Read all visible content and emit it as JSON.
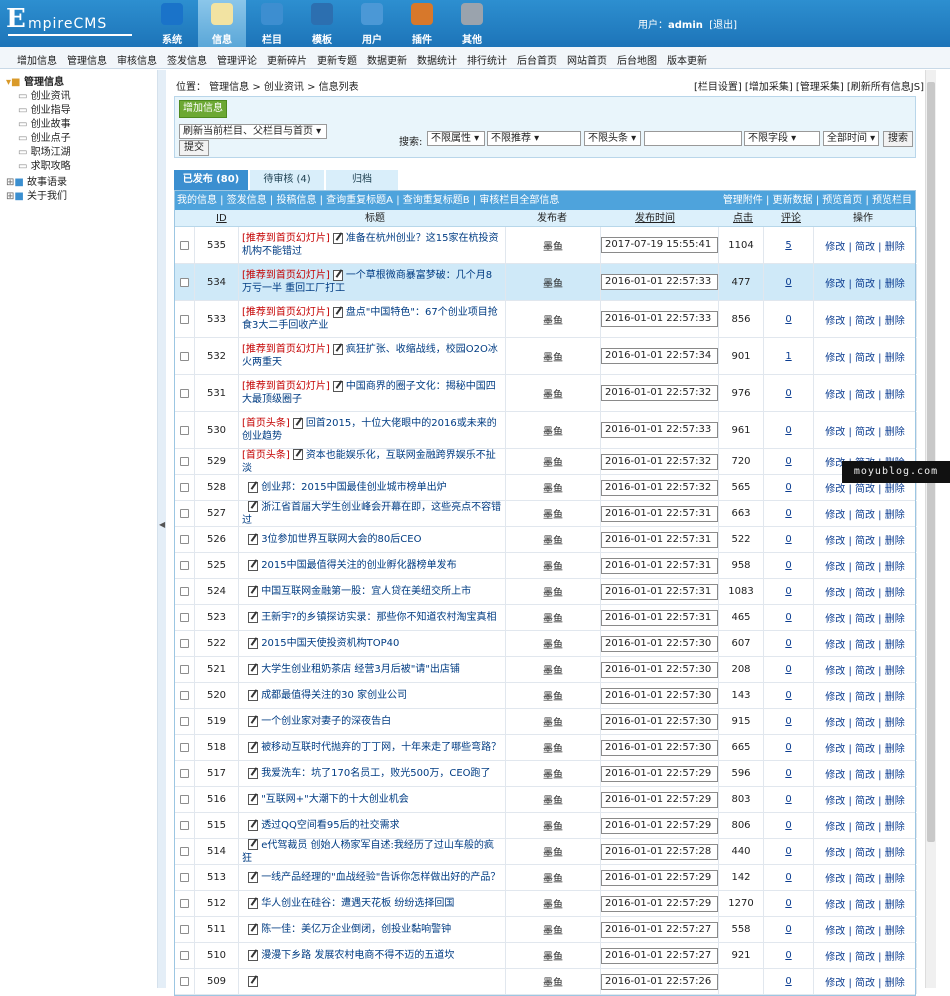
{
  "logo": {
    "first": "E",
    "rest": "mpireCMS"
  },
  "nav": [
    {
      "label": "系统",
      "color": "#1a73c9"
    },
    {
      "label": "信息",
      "color": "#f2e3a2"
    },
    {
      "label": "栏目",
      "color": "#3d8ed0"
    },
    {
      "label": "模板",
      "color": "#2c6fb0"
    },
    {
      "label": "用户",
      "color": "#4b98d6"
    },
    {
      "label": "插件",
      "color": "#d7782b"
    },
    {
      "label": "其他",
      "color": "#9aa3ad"
    }
  ],
  "user": {
    "prefix": "用户：",
    "name": "admin",
    "logout": "[退出]"
  },
  "subnav": [
    "增加信息",
    "管理信息",
    "审核信息",
    "签发信息",
    "管理评论",
    "更新碎片",
    "更新专题",
    "数据更新",
    "数据统计",
    "排行统计",
    "后台首页",
    "网站首页",
    "后台地图",
    "版本更新"
  ],
  "tree": {
    "root": "管理信息",
    "children": [
      "创业资讯",
      "创业指导",
      "创业故事",
      "创业点子",
      "职场江湖",
      "求职攻略"
    ],
    "folders": [
      "故事语录",
      "关于我们"
    ]
  },
  "breadcrumb": "位置： 管理信息 > 创业资讯 > 信息列表",
  "toplinks": "[栏目设置] [增加采集] [管理采集] [刷新所有信息JS]",
  "panel": {
    "add_btn": "增加信息",
    "refresh_select": "刷新当前栏目、父栏目与首页",
    "submit": "提交",
    "search_label": "搜索:",
    "sel1": "不限属性",
    "sel2": "不限推荐",
    "sel3": "不限头条",
    "sel4": "不限字段",
    "sel5": "全部时间",
    "search_btn": "搜索"
  },
  "tabs": [
    "已发布 (80)",
    "待审核 (4)",
    "归档"
  ],
  "toolbar_left": "我的信息 | 签发信息 | 投稿信息 | 查询重复标题A | 查询重复标题B | 审核栏目全部信息",
  "toolbar_right": "管理附件 | 更新数据 | 预览首页 | 预览栏目",
  "columns": {
    "id": "ID",
    "title": "标题",
    "publisher": "发布者",
    "time": "发布时间",
    "clicks": "点击",
    "comments": "评论",
    "ops": "操作"
  },
  "ops_text": "修改 | 简改 | 删除",
  "rows": [
    {
      "id": "535",
      "tag": "[推荐到首页幻灯片]",
      "title": "准备在杭州创业？这15家在杭投资机构不能错过",
      "pub": "墨鱼",
      "time": "2017-07-19 15:55:41",
      "clicks": "1104",
      "comments": "5",
      "tall": true
    },
    {
      "id": "534",
      "tag": "[推荐到首页幻灯片]",
      "title": "一个草根微商暴富梦破：几个月8万亏一半 重回工厂打工",
      "pub": "墨鱼",
      "time": "2016-01-01 22:57:33",
      "clicks": "477",
      "comments": "0",
      "tall": true,
      "hl": true
    },
    {
      "id": "533",
      "tag": "[推荐到首页幻灯片]",
      "title": "盘点\"中国特色\"：67个创业项目抢食3大二手回收产业",
      "pub": "墨鱼",
      "time": "2016-01-01 22:57:33",
      "clicks": "856",
      "comments": "0",
      "tall": true
    },
    {
      "id": "532",
      "tag": "[推荐到首页幻灯片]",
      "title": "疯狂扩张、收缩战线，校园O2O冰火两重天",
      "pub": "墨鱼",
      "time": "2016-01-01 22:57:34",
      "clicks": "901",
      "comments": "1",
      "tall": true
    },
    {
      "id": "531",
      "tag": "[推荐到首页幻灯片]",
      "title": "中国商界的圈子文化：揭秘中国四大最顶级圈子",
      "pub": "墨鱼",
      "time": "2016-01-01 22:57:32",
      "clicks": "976",
      "comments": "0",
      "tall": true
    },
    {
      "id": "530",
      "tag": "[首页头条]",
      "title": "回首2015，十位大佬眼中的2016或未来的创业趋势",
      "pub": "墨鱼",
      "time": "2016-01-01 22:57:33",
      "clicks": "961",
      "comments": "0",
      "tall": true
    },
    {
      "id": "529",
      "tag": "[首页头条]",
      "title": "资本也能娱乐化，互联网金融跨界娱乐不扯淡",
      "pub": "墨鱼",
      "time": "2016-01-01 22:57:32",
      "clicks": "720",
      "comments": "0",
      "tall": false
    },
    {
      "id": "528",
      "tag": "",
      "title": "创业邦：2015中国最佳创业城市榜单出炉",
      "pub": "墨鱼",
      "time": "2016-01-01 22:57:32",
      "clicks": "565",
      "comments": "0"
    },
    {
      "id": "527",
      "tag": "",
      "title": "浙江省首届大学生创业峰会开幕在即，这些亮点不容错过",
      "pub": "墨鱼",
      "time": "2016-01-01 22:57:31",
      "clicks": "663",
      "comments": "0"
    },
    {
      "id": "526",
      "tag": "",
      "title": "3位参加世界互联网大会的80后CEO",
      "pub": "墨鱼",
      "time": "2016-01-01 22:57:31",
      "clicks": "522",
      "comments": "0"
    },
    {
      "id": "525",
      "tag": "",
      "title": "2015中国最值得关注的创业孵化器榜单发布",
      "pub": "墨鱼",
      "time": "2016-01-01 22:57:31",
      "clicks": "958",
      "comments": "0"
    },
    {
      "id": "524",
      "tag": "",
      "title": "中国互联网金融第一股：宜人贷在美纽交所上市",
      "pub": "墨鱼",
      "time": "2016-01-01 22:57:31",
      "clicks": "1083",
      "comments": "0"
    },
    {
      "id": "523",
      "tag": "",
      "title": "王新宇?的乡镇探访实录：那些你不知道农村淘宝真相",
      "pub": "墨鱼",
      "time": "2016-01-01 22:57:31",
      "clicks": "465",
      "comments": "0"
    },
    {
      "id": "522",
      "tag": "",
      "title": "2015中国天使投资机构TOP40",
      "pub": "墨鱼",
      "time": "2016-01-01 22:57:30",
      "clicks": "607",
      "comments": "0"
    },
    {
      "id": "521",
      "tag": "",
      "title": "大学生创业租奶茶店 经营3月后被\"请\"出店铺",
      "pub": "墨鱼",
      "time": "2016-01-01 22:57:30",
      "clicks": "208",
      "comments": "0"
    },
    {
      "id": "520",
      "tag": "",
      "title": "成都最值得关注的30 家创业公司",
      "pub": "墨鱼",
      "time": "2016-01-01 22:57:30",
      "clicks": "143",
      "comments": "0"
    },
    {
      "id": "519",
      "tag": "",
      "title": "一个创业家对妻子的深夜告白",
      "pub": "墨鱼",
      "time": "2016-01-01 22:57:30",
      "clicks": "915",
      "comments": "0"
    },
    {
      "id": "518",
      "tag": "",
      "title": "被移动互联时代抛弃的丁丁网，十年来走了哪些弯路？",
      "pub": "墨鱼",
      "time": "2016-01-01 22:57:30",
      "clicks": "665",
      "comments": "0"
    },
    {
      "id": "517",
      "tag": "",
      "title": "我爱洗车：坑了170名员工，败光500万，CEO跑了",
      "pub": "墨鱼",
      "time": "2016-01-01 22:57:29",
      "clicks": "596",
      "comments": "0"
    },
    {
      "id": "516",
      "tag": "",
      "title": "\"互联网+\"大潮下的十大创业机会",
      "pub": "墨鱼",
      "time": "2016-01-01 22:57:29",
      "clicks": "803",
      "comments": "0"
    },
    {
      "id": "515",
      "tag": "",
      "title": "透过QQ空间看95后的社交需求",
      "pub": "墨鱼",
      "time": "2016-01-01 22:57:29",
      "clicks": "806",
      "comments": "0"
    },
    {
      "id": "514",
      "tag": "",
      "title": "e代驾裁员 创始人杨家军自述:我经历了过山车般的疯狂",
      "pub": "墨鱼",
      "time": "2016-01-01 22:57:28",
      "clicks": "440",
      "comments": "0"
    },
    {
      "id": "513",
      "tag": "",
      "title": "一线产品经理的\"血战经验\"告诉你怎样做出好的产品？",
      "pub": "墨鱼",
      "time": "2016-01-01 22:57:29",
      "clicks": "142",
      "comments": "0"
    },
    {
      "id": "512",
      "tag": "",
      "title": "华人创业在硅谷：遭遇天花板 纷纷选择回国",
      "pub": "墨鱼",
      "time": "2016-01-01 22:57:29",
      "clicks": "1270",
      "comments": "0"
    },
    {
      "id": "511",
      "tag": "",
      "title": "陈一佳：美亿万企业倒闭，创投业黏响警钟",
      "pub": "墨鱼",
      "time": "2016-01-01 22:57:27",
      "clicks": "558",
      "comments": "0"
    },
    {
      "id": "510",
      "tag": "",
      "title": "漫漫下乡路 发展农村电商不得不迈的五道坎",
      "pub": "墨鱼",
      "time": "2016-01-01 22:57:27",
      "clicks": "921",
      "comments": "0"
    },
    {
      "id": "509",
      "tag": "",
      "title": "",
      "pub": "墨鱼",
      "time": "2016-01-01 22:57:26",
      "clicks": "",
      "comments": "0"
    }
  ],
  "watermark": "moyublog.com"
}
